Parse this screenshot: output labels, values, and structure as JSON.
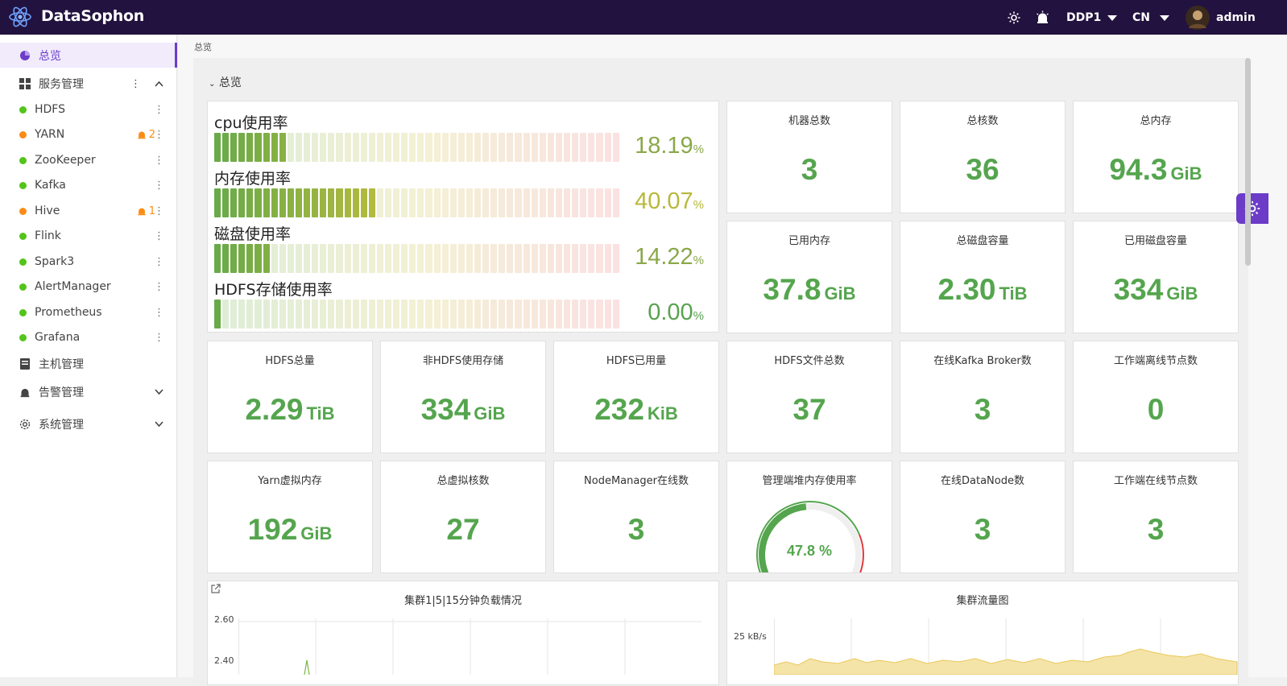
{
  "app": {
    "title": "DataSophon"
  },
  "topbar": {
    "cluster": "DDP1",
    "language": "CN",
    "user": "admin"
  },
  "sidebar": {
    "overview": "总览",
    "service_mgmt": "服务管理",
    "services": [
      {
        "name": "HDFS",
        "status": "green",
        "alerts": ""
      },
      {
        "name": "YARN",
        "status": "orange",
        "alerts": "2"
      },
      {
        "name": "ZooKeeper",
        "status": "green",
        "alerts": ""
      },
      {
        "name": "Kafka",
        "status": "green",
        "alerts": ""
      },
      {
        "name": "Hive",
        "status": "orange",
        "alerts": "1"
      },
      {
        "name": "Flink",
        "status": "green",
        "alerts": ""
      },
      {
        "name": "Spark3",
        "status": "green",
        "alerts": ""
      },
      {
        "name": "AlertManager",
        "status": "green",
        "alerts": ""
      },
      {
        "name": "Prometheus",
        "status": "green",
        "alerts": ""
      },
      {
        "name": "Grafana",
        "status": "green",
        "alerts": ""
      }
    ],
    "host_mgmt": "主机管理",
    "alert_mgmt": "告警管理",
    "system_mgmt": "系统管理"
  },
  "breadcrumb": "总览",
  "section": {
    "title": "总览"
  },
  "usage": [
    {
      "label": "cpu使用率",
      "value": "18.19",
      "unit": "%",
      "fraction": 0.1819,
      "color": "#8aa84a"
    },
    {
      "label": "内存使用率",
      "value": "40.07",
      "unit": "%",
      "fraction": 0.4007,
      "color": "#b8b83c"
    },
    {
      "label": "磁盘使用率",
      "value": "14.22",
      "unit": "%",
      "fraction": 0.1422,
      "color": "#8aa84a"
    },
    {
      "label": "HDFS存储使用率",
      "value": "0.00",
      "unit": "%",
      "fraction": 0.0,
      "color": "#58a24f"
    }
  ],
  "stats": [
    {
      "title": "机器总数",
      "value": "3",
      "unit": ""
    },
    {
      "title": "总核数",
      "value": "36",
      "unit": ""
    },
    {
      "title": "总内存",
      "value": "94.3",
      "unit": "GiB"
    },
    {
      "title": "已用内存",
      "value": "37.8",
      "unit": "GiB"
    },
    {
      "title": "总磁盘容量",
      "value": "2.30",
      "unit": "TiB"
    },
    {
      "title": "已用磁盘容量",
      "value": "334",
      "unit": "GiB"
    },
    {
      "title": "HDFS总量",
      "value": "2.29",
      "unit": "TiB"
    },
    {
      "title": "非HDFS使用存储",
      "value": "334",
      "unit": "GiB"
    },
    {
      "title": "HDFS已用量",
      "value": "232",
      "unit": "KiB"
    },
    {
      "title": "HDFS文件总数",
      "value": "37",
      "unit": ""
    },
    {
      "title": "在线Kafka Broker数",
      "value": "3",
      "unit": ""
    },
    {
      "title": "工作端离线节点数",
      "value": "0",
      "unit": ""
    },
    {
      "title": "Yarn虚拟内存",
      "value": "192",
      "unit": "GiB"
    },
    {
      "title": "总虚拟核数",
      "value": "27",
      "unit": ""
    },
    {
      "title": "NodeManager在线数",
      "value": "3",
      "unit": ""
    },
    {
      "title": "在线DataNode数",
      "value": "3",
      "unit": ""
    },
    {
      "title": "工作端在线节点数",
      "value": "3",
      "unit": ""
    }
  ],
  "heap": {
    "title": "管理端堆内存使用率",
    "value": "47.8 %",
    "fraction": 0.478
  },
  "load_chart": {
    "title": "集群1|5|15分钟负载情况",
    "y_ticks": [
      "2.60",
      "2.40"
    ]
  },
  "traffic_chart": {
    "title": "集群流量图",
    "y_tick": "25 kB/s"
  },
  "chart_data": [
    {
      "type": "line",
      "title": "集群1|5|15分钟负载情况",
      "y_ticks": [
        2.6,
        2.4
      ],
      "series": []
    },
    {
      "type": "area",
      "title": "集群流量图",
      "y_ticks": [
        "25 kB/s"
      ],
      "series": []
    }
  ],
  "colors": {
    "accent": "#6c3cc9",
    "topbar": "#22123f",
    "value_green": "#55a54e",
    "dot_green": "#52c41a",
    "dot_orange": "#fa8c16"
  }
}
